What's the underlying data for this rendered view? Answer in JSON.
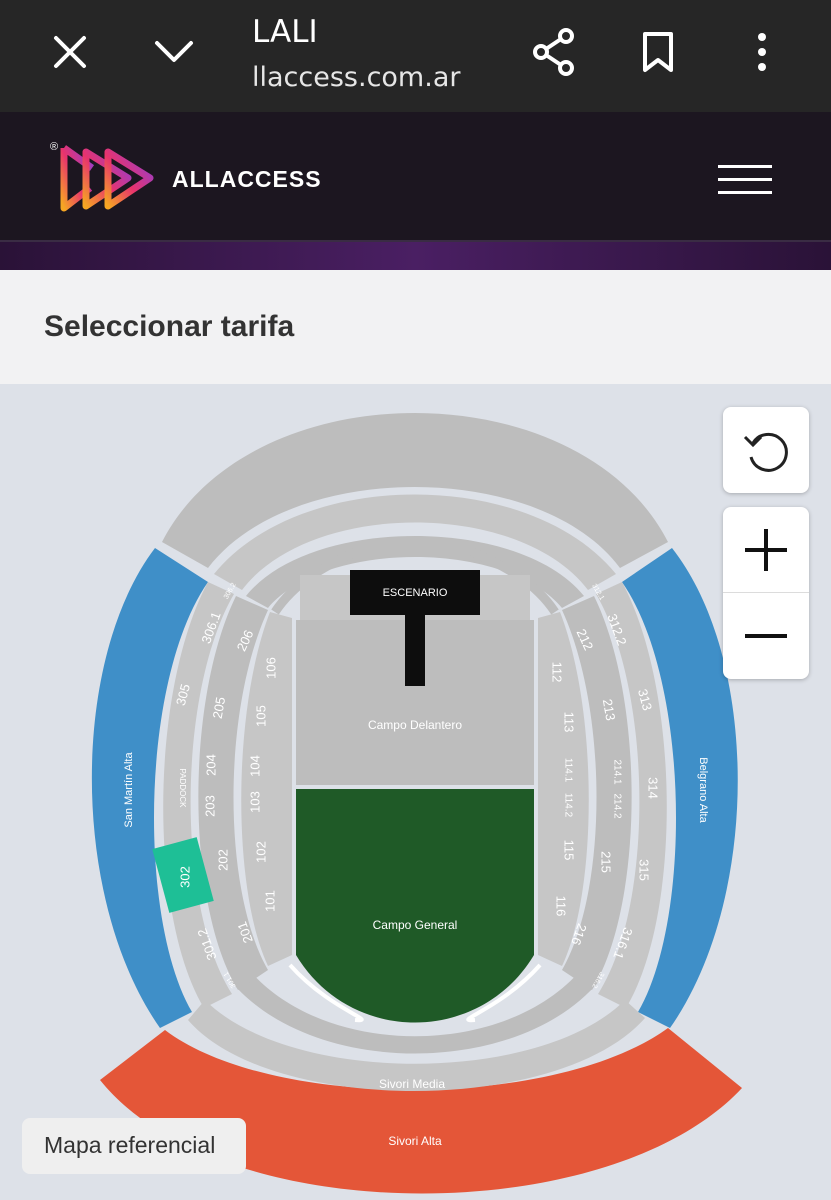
{
  "browser": {
    "title": "LALI",
    "url": "llaccess.com.ar",
    "icons": [
      "close-icon",
      "chevron-down-icon",
      "share-icon",
      "bookmark-icon",
      "more-vertical-icon"
    ]
  },
  "site": {
    "brand": "ALLACCESS",
    "registered_mark": "®",
    "logo_icon": "play-triangles-logo",
    "menu_icon": "hamburger-menu-icon"
  },
  "page": {
    "title": "Seleccionar tarifa"
  },
  "map_controls": {
    "reset_icon": "rotate-ccw-icon",
    "zoom_in_icon": "plus-icon",
    "zoom_out_icon": "minus-icon"
  },
  "map": {
    "stage": "ESCENARIO",
    "campo_delantero": "Campo Delantero",
    "campo_general": "Campo General",
    "paddock": "PADDOCK",
    "san_martin_alta": "San Martín Alta",
    "belgrano_alta": "Belgrano Alta",
    "sivori_media": "Sivori Media",
    "sivori_alta": "Sivori Alta",
    "sections_left": [
      "306.2",
      "306.1",
      "206",
      "106",
      "305",
      "205",
      "105",
      "204",
      "104",
      "203",
      "103",
      "202",
      "102",
      "302",
      "101",
      "201",
      "301.2",
      "301.1"
    ],
    "sections_right": [
      "312.1",
      "312.2",
      "212",
      "112",
      "313",
      "213",
      "113",
      "214.1",
      "114.1",
      "314",
      "214.2",
      "114.2",
      "115",
      "215",
      "315",
      "116",
      "216",
      "316.1",
      "316.2"
    ],
    "colors": {
      "available_highlight": "#1ebf96",
      "campo_general": "#1f5a27",
      "alta_blue": "#3f8fc8",
      "sivori_alta_red": "#e45638",
      "unavailable_grey": "#bdbdbd",
      "stage_black": "#0d0d0d"
    }
  },
  "legend": {
    "label": "Mapa referencial"
  }
}
